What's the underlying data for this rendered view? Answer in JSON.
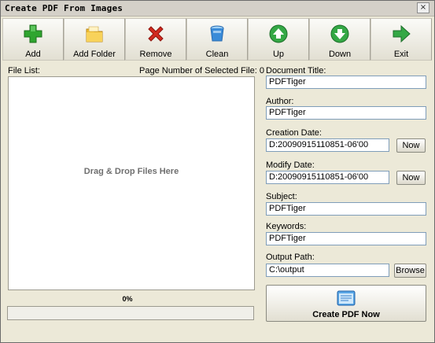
{
  "window": {
    "title": "Create PDF From Images",
    "close_glyph": "×"
  },
  "toolbar": {
    "buttons": [
      {
        "label": "Add",
        "icon": "add-icon"
      },
      {
        "label": "Add Folder",
        "icon": "folder-icon"
      },
      {
        "label": "Remove",
        "icon": "remove-icon"
      },
      {
        "label": "Clean",
        "icon": "clean-icon"
      },
      {
        "label": "Up",
        "icon": "up-icon"
      },
      {
        "label": "Down",
        "icon": "down-icon"
      },
      {
        "label": "Exit",
        "icon": "exit-icon"
      }
    ]
  },
  "file_list": {
    "label": "File List:",
    "page_number_label": "Page Number of Selected File: 0",
    "empty_message": "Drag & Drop Files Here"
  },
  "progress": {
    "text": "0%",
    "value": 0
  },
  "form": {
    "document_title_label": "Document Title:",
    "document_title_value": "PDFTiger",
    "author_label": "Author:",
    "author_value": "PDFTiger",
    "creation_date_label": "Creation Date:",
    "creation_date_value": "D:20090915110851-06'00",
    "modify_date_label": "Modify Date:",
    "modify_date_value": "D:20090915110851-06'00",
    "subject_label": "Subject:",
    "subject_value": "PDFTiger",
    "keywords_label": "Keywords:",
    "keywords_value": "PDFTiger",
    "output_path_label": "Output Path:",
    "output_path_value": "C:\\output",
    "now_label": "Now",
    "browse_label": "Browse",
    "create_label": "Create PDF Now"
  },
  "colors": {
    "window_bg": "#ece9d8",
    "add_green": "#2fa52f",
    "remove_red": "#d22a1f",
    "nav_green": "#34a845",
    "folder_yellow": "#f2c031",
    "clean_blue": "#3a8bd8"
  }
}
